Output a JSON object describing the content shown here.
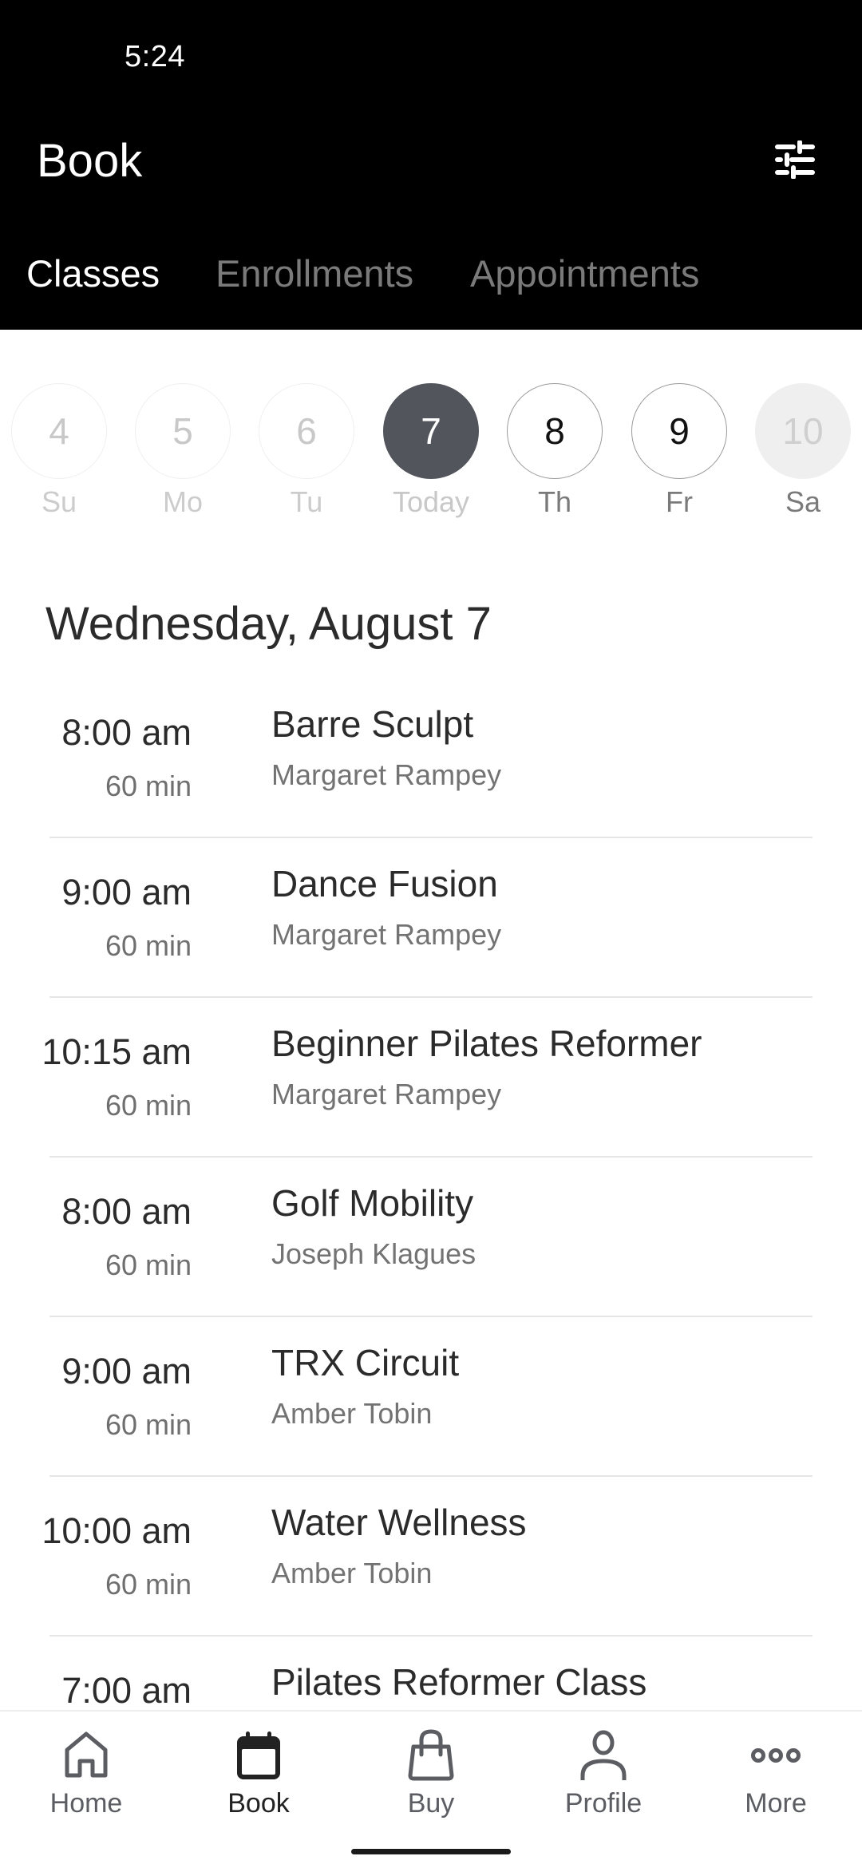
{
  "status_bar": {
    "time": "5:24"
  },
  "header": {
    "title": "Book",
    "filter_icon": "sliders-icon",
    "tabs": [
      {
        "label": "Classes",
        "active": true
      },
      {
        "label": "Enrollments",
        "active": false
      },
      {
        "label": "Appointments",
        "active": false
      }
    ]
  },
  "date_strip": {
    "days": [
      {
        "number": "4",
        "label": "Su",
        "state": "past"
      },
      {
        "number": "5",
        "label": "Mo",
        "state": "past"
      },
      {
        "number": "6",
        "label": "Tu",
        "state": "past"
      },
      {
        "number": "7",
        "label": "Today",
        "state": "selected"
      },
      {
        "number": "8",
        "label": "Th",
        "state": "future"
      },
      {
        "number": "9",
        "label": "Fr",
        "state": "future"
      },
      {
        "number": "10",
        "label": "Sa",
        "state": "disabled"
      }
    ]
  },
  "schedule": {
    "date_heading": "Wednesday, August 7",
    "classes": [
      {
        "time": "8:00 am",
        "duration": "60 min",
        "name": "Barre Sculpt",
        "instructor": "Margaret Rampey"
      },
      {
        "time": "9:00 am",
        "duration": "60 min",
        "name": "Dance Fusion",
        "instructor": "Margaret Rampey"
      },
      {
        "time": "10:15 am",
        "duration": "60 min",
        "name": "Beginner Pilates Reformer",
        "instructor": "Margaret Rampey"
      },
      {
        "time": "8:00 am",
        "duration": "60 min",
        "name": "Golf Mobility",
        "instructor": "Joseph Klagues"
      },
      {
        "time": "9:00 am",
        "duration": "60 min",
        "name": "TRX Circuit",
        "instructor": "Amber Tobin"
      },
      {
        "time": "10:00 am",
        "duration": "60 min",
        "name": "Water Wellness",
        "instructor": "Amber Tobin"
      },
      {
        "time": "7:00 am",
        "duration": "",
        "name": "Pilates Reformer Class",
        "instructor": ""
      }
    ]
  },
  "bottom_nav": {
    "items": [
      {
        "label": "Home",
        "icon": "home-icon",
        "active": false
      },
      {
        "label": "Book",
        "icon": "calendar-icon",
        "active": true
      },
      {
        "label": "Buy",
        "icon": "shopping-bag-icon",
        "active": false
      },
      {
        "label": "Profile",
        "icon": "person-icon",
        "active": false
      },
      {
        "label": "More",
        "icon": "more-dots-icon",
        "active": false
      }
    ]
  },
  "colors": {
    "header_bg": "#000000",
    "selected_day": "#52555c",
    "nav_icon": "#5b5d62",
    "nav_active": "#222222"
  }
}
